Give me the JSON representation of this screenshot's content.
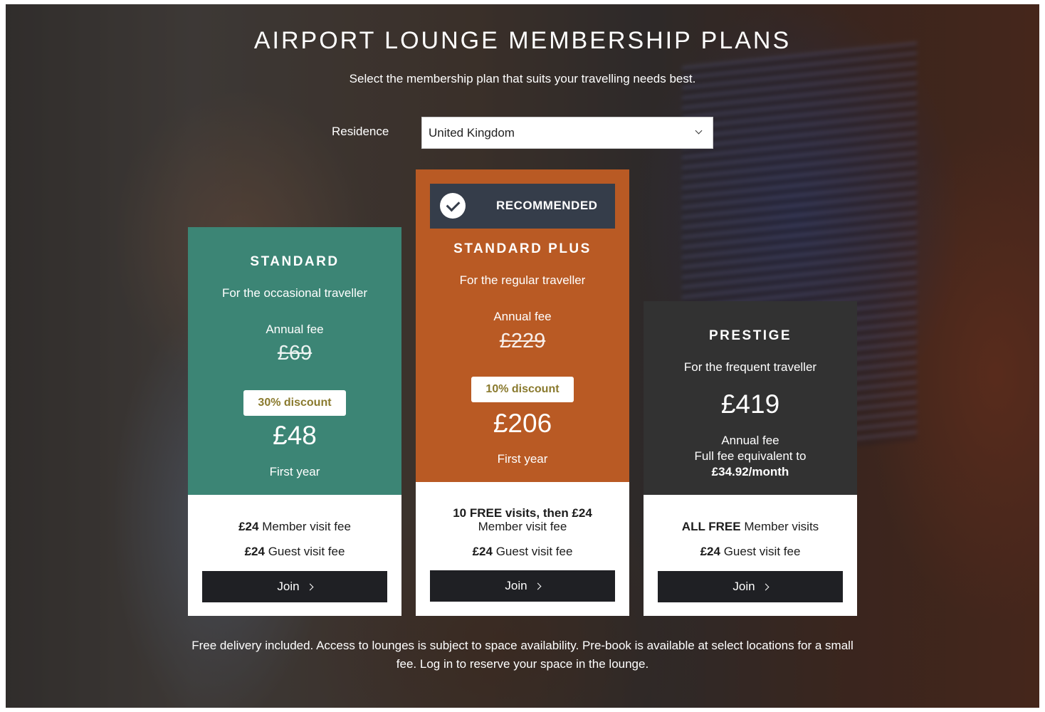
{
  "header": {
    "title": "AIRPORT LOUNGE MEMBERSHIP PLANS",
    "subtitle": "Select the membership plan that suits your travelling needs best."
  },
  "residence": {
    "label": "Residence",
    "selected": "United Kingdom"
  },
  "plans": [
    {
      "name": "STANDARD",
      "tagline": "For the occasional traveller",
      "fee_label": "Annual fee",
      "original_price": "£69",
      "discount": "30% discount",
      "price": "£48",
      "price_note": "First year",
      "member_fee_strong": "£24",
      "member_fee_text": " Member visit fee",
      "guest_fee_strong": "£24",
      "guest_fee_text": " Guest visit fee",
      "cta": "Join",
      "color": "#3c8575"
    },
    {
      "name": "STANDARD PLUS",
      "badge": "RECOMMENDED",
      "tagline": "For the regular traveller",
      "fee_label": "Annual fee",
      "original_price": "£229",
      "discount": "10% discount",
      "price": "£206",
      "price_note": "First year",
      "member_fee_strong": "10 FREE visits, then £24",
      "member_fee_text": "Member visit fee",
      "guest_fee_strong": "£24",
      "guest_fee_text": " Guest visit fee",
      "cta": "Join",
      "color": "#b95a24"
    },
    {
      "name": "PRESTIGE",
      "tagline": "For the frequent traveller",
      "price": "£419",
      "fee_label": "Annual fee",
      "equivalent_text": "Full fee equivalent to",
      "equivalent_value": "£34.92/month",
      "member_fee_strong": "ALL FREE",
      "member_fee_text": " Member visits",
      "guest_fee_strong": "£24",
      "guest_fee_text": " Guest visit fee",
      "cta": "Join",
      "color": "#323232"
    }
  ],
  "footnote": "Free delivery included. Access to lounges is subject to space availability. Pre-book is available at select locations for a small fee. Log in to reserve your space in the lounge.",
  "colors": {
    "discount_text": "#8a7a2e",
    "button": "#1f2024",
    "recommended_banner": "#353d4a"
  }
}
